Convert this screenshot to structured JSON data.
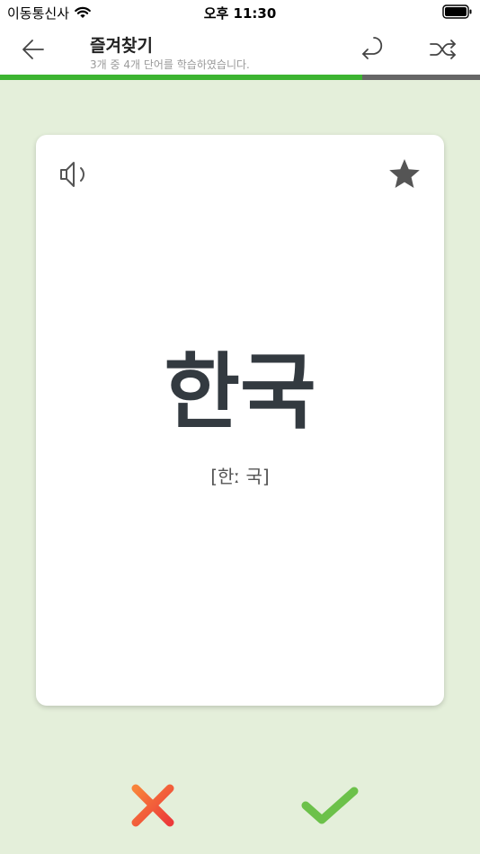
{
  "status_bar": {
    "carrier": "이동통신사",
    "time": "오후 11:30",
    "wifi_icon": "wifi-icon",
    "battery_icon": "battery-full-icon"
  },
  "nav": {
    "title": "즐겨찾기",
    "subtitle": "3개 중 4개 단어를 학습하였습니다.",
    "back_icon": "arrow-left-icon",
    "undo_icon": "undo-icon",
    "shuffle_icon": "shuffle-icon"
  },
  "progress": {
    "fraction": 0.755,
    "fill_color": "#3cb431",
    "track_color": "#666666"
  },
  "card": {
    "word": "한국",
    "pronunciation": "[한ː 국]",
    "speaker_icon": "speaker-icon",
    "favorite_icon": "star-icon",
    "favorited": true
  },
  "actions": {
    "wrong_icon": "x-mark-icon",
    "wrong_color": "#f0583a",
    "correct_icon": "checkmark-icon",
    "correct_color": "#6cc14a"
  },
  "colors": {
    "background": "#e4efda",
    "card": "#ffffff",
    "text_dark": "#333a40"
  }
}
